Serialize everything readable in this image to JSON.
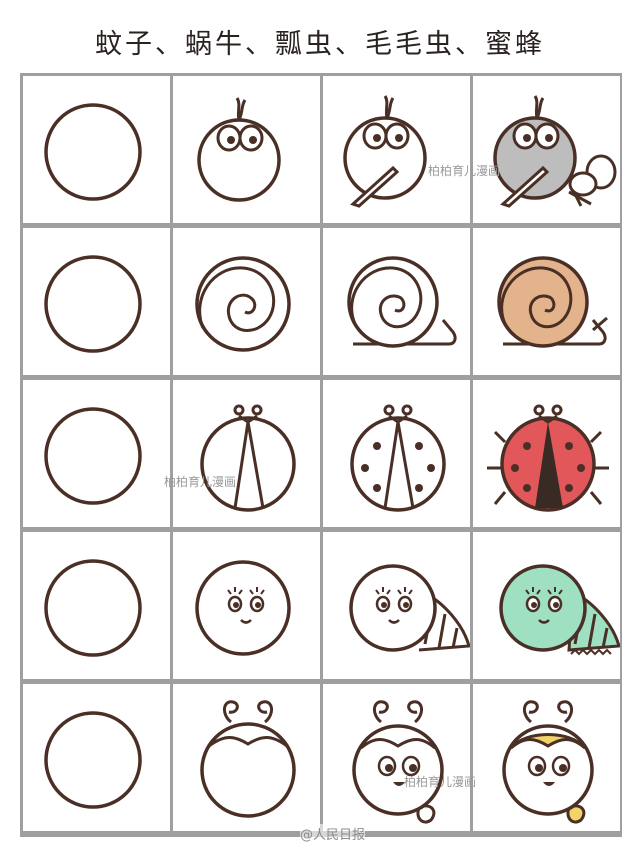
{
  "title": "蚊子、蜗牛、瓢虫、毛毛虫、蜜蜂",
  "watermark": "柏柏育儿漫画",
  "footer": "@人民日报",
  "colors": {
    "line": "#4a2f26",
    "mosquito_fill": "#bdbdbd",
    "snail_fill": "#e3b48c",
    "ladybug_fill": "#e2585a",
    "caterpillar_fill": "#9fe0c2",
    "bee_stripe": "#f2d36a",
    "grid": "#9f9f9f"
  },
  "rows": [
    {
      "animal": "蚊子",
      "steps": 4
    },
    {
      "animal": "蜗牛",
      "steps": 4
    },
    {
      "animal": "瓢虫",
      "steps": 4
    },
    {
      "animal": "毛毛虫",
      "steps": 4
    },
    {
      "animal": "蜜蜂",
      "steps": 4
    }
  ]
}
